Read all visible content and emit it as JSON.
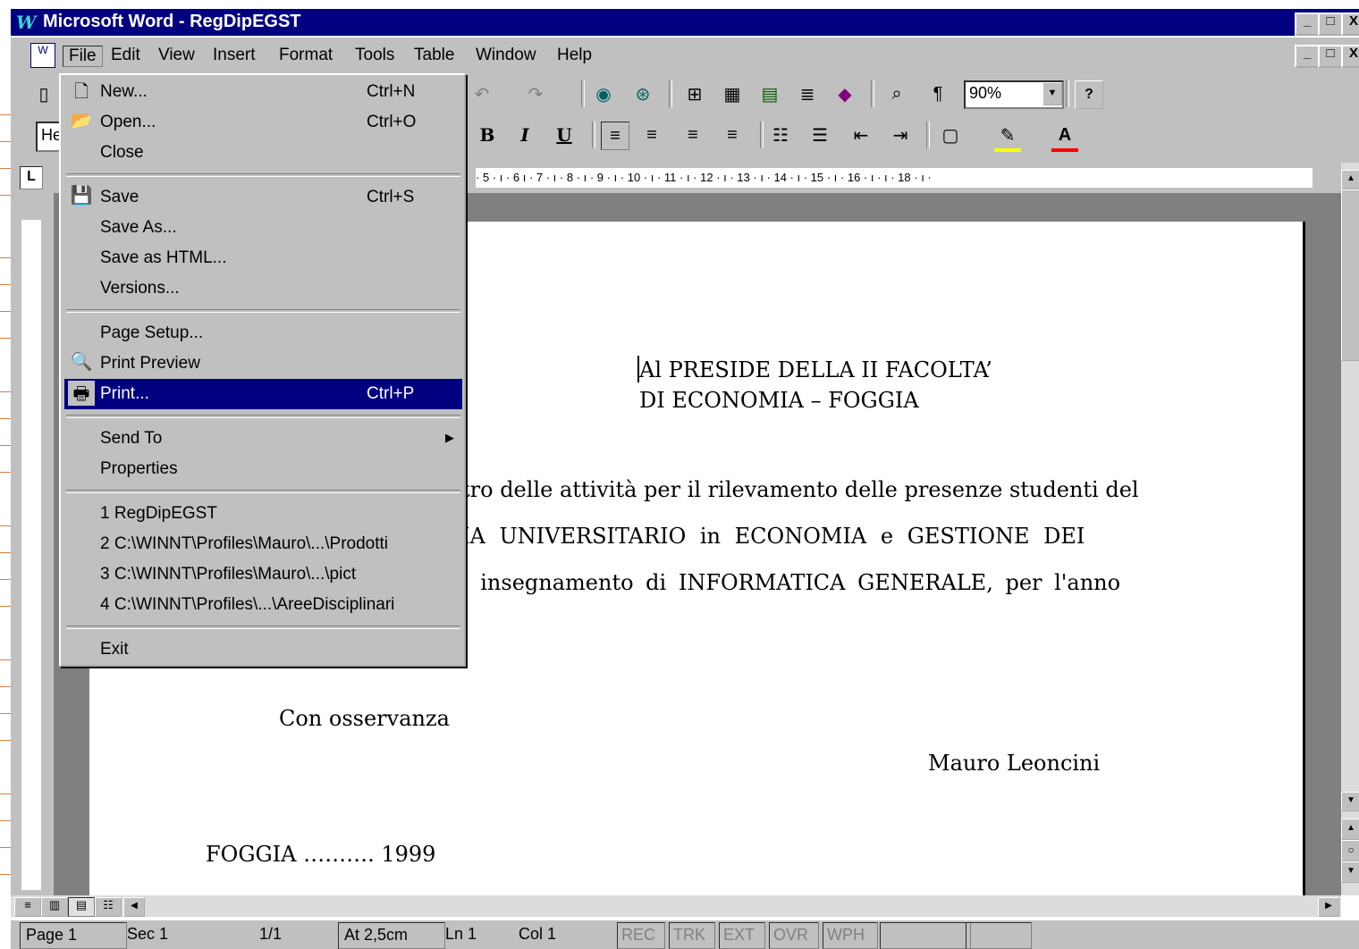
{
  "window": {
    "title": "Microsoft Word - RegDipEGST",
    "app_icon": "W",
    "controls": [
      "_",
      "□",
      "X"
    ]
  },
  "menubar": {
    "items": [
      "File",
      "Edit",
      "View",
      "Insert",
      "Format",
      "Tools",
      "Table",
      "Window",
      "Help"
    ]
  },
  "toolbar": {
    "zoom": "90%",
    "style": "He"
  },
  "file_menu": {
    "items": [
      {
        "label": "New...",
        "shortcut": "Ctrl+N",
        "icon": "new-doc-icon"
      },
      {
        "label": "Open...",
        "shortcut": "Ctrl+O",
        "icon": "open-folder-icon"
      },
      {
        "label": "Close",
        "shortcut": "",
        "icon": ""
      },
      {
        "label": "Save",
        "shortcut": "Ctrl+S",
        "icon": "save-disk-icon"
      },
      {
        "label": "Save As...",
        "shortcut": "",
        "icon": ""
      },
      {
        "label": "Save as HTML...",
        "shortcut": "",
        "icon": ""
      },
      {
        "label": "Versions...",
        "shortcut": "",
        "icon": ""
      },
      {
        "label": "Page Setup...",
        "shortcut": "",
        "icon": ""
      },
      {
        "label": "Print Preview",
        "shortcut": "",
        "icon": "print-preview-icon"
      },
      {
        "label": "Print...",
        "shortcut": "Ctrl+P",
        "icon": "printer-icon"
      },
      {
        "label": "Send To",
        "shortcut": "",
        "icon": ""
      },
      {
        "label": "Properties",
        "shortcut": "",
        "icon": ""
      },
      {
        "label": "1 RegDipEGST",
        "shortcut": "",
        "icon": ""
      },
      {
        "label": "2 C:\\WINNT\\Profiles\\Mauro\\...\\Prodotti",
        "shortcut": "",
        "icon": ""
      },
      {
        "label": "3 C:\\WINNT\\Profiles\\Mauro\\...\\pict",
        "shortcut": "",
        "icon": ""
      },
      {
        "label": "4 C:\\WINNT\\Profiles\\...\\AreeDisciplinari",
        "shortcut": "",
        "icon": ""
      },
      {
        "label": "Exit",
        "shortcut": "",
        "icon": ""
      }
    ],
    "highlighted": "Print..."
  },
  "ruler": {
    "text": "· 5 · ı · 6 ı · 7 · ı · 8 · ı · 9 · ı · 10 · ı · 11 · ı · 12 · ı · 13 · ı · 14 · ı · 15 · ı · 16 · ı · ı · 18 · ı ·"
  },
  "document": {
    "address_line1": "Al PRESIDE DELLA II FACOLTA’",
    "address_line2": "DI ECONOMIA –  FOGGIA",
    "body_line1": "tro delle attività per il rilevamento delle presenze studenti del",
    "body_line2": "IA UNIVERSITARIO in ECONOMIA e GESTIONE DEI",
    "body_line3": ", insegnamento di INFORMATICA GENERALE, per l'anno",
    "closing": "Con osservanza",
    "signature": "Mauro Leoncini",
    "place_date": "FOGGIA ………. 1999"
  },
  "statusbar": {
    "page": "Page  1",
    "sec": "Sec  1",
    "pages": "1/1",
    "at": "At  2,5cm",
    "ln": "Ln  1",
    "col": "Col  1",
    "modes": [
      "REC",
      "TRK",
      "EXT",
      "OVR",
      "WPH"
    ]
  }
}
